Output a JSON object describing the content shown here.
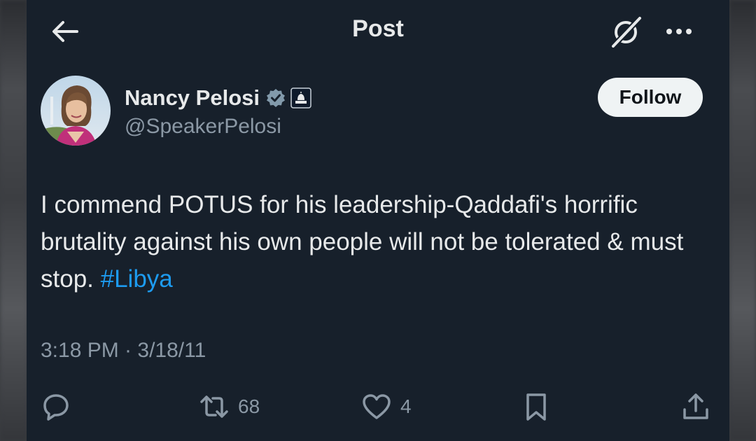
{
  "header": {
    "title": "Post",
    "back_icon": "arrow-left-icon",
    "grok_icon": "grok-icon",
    "more_icon": "more-dots-icon"
  },
  "author": {
    "name": "Nancy Pelosi",
    "handle": "@SpeakerPelosi",
    "verified_icon": "verified-badge-icon",
    "affiliation_icon": "capitol-badge-icon",
    "follow_label": "Follow"
  },
  "tweet": {
    "text": "I commend POTUS for his leadership-Qaddafi's horrific brutality against his own people will not be tolerated & must stop.",
    "hashtag": "#Libya",
    "timestamp": "3:18 PM · 3/18/11"
  },
  "actions": {
    "reply_icon": "reply-icon",
    "repost_icon": "repost-icon",
    "repost_count": "68",
    "like_icon": "heart-icon",
    "like_count": "4",
    "bookmark_icon": "bookmark-icon",
    "share_icon": "share-icon"
  },
  "colors": {
    "background": "#17202b",
    "text": "#e7e9ea",
    "muted": "#8b98a5",
    "accent": "#1d9bf0",
    "verified": "#829aab"
  }
}
